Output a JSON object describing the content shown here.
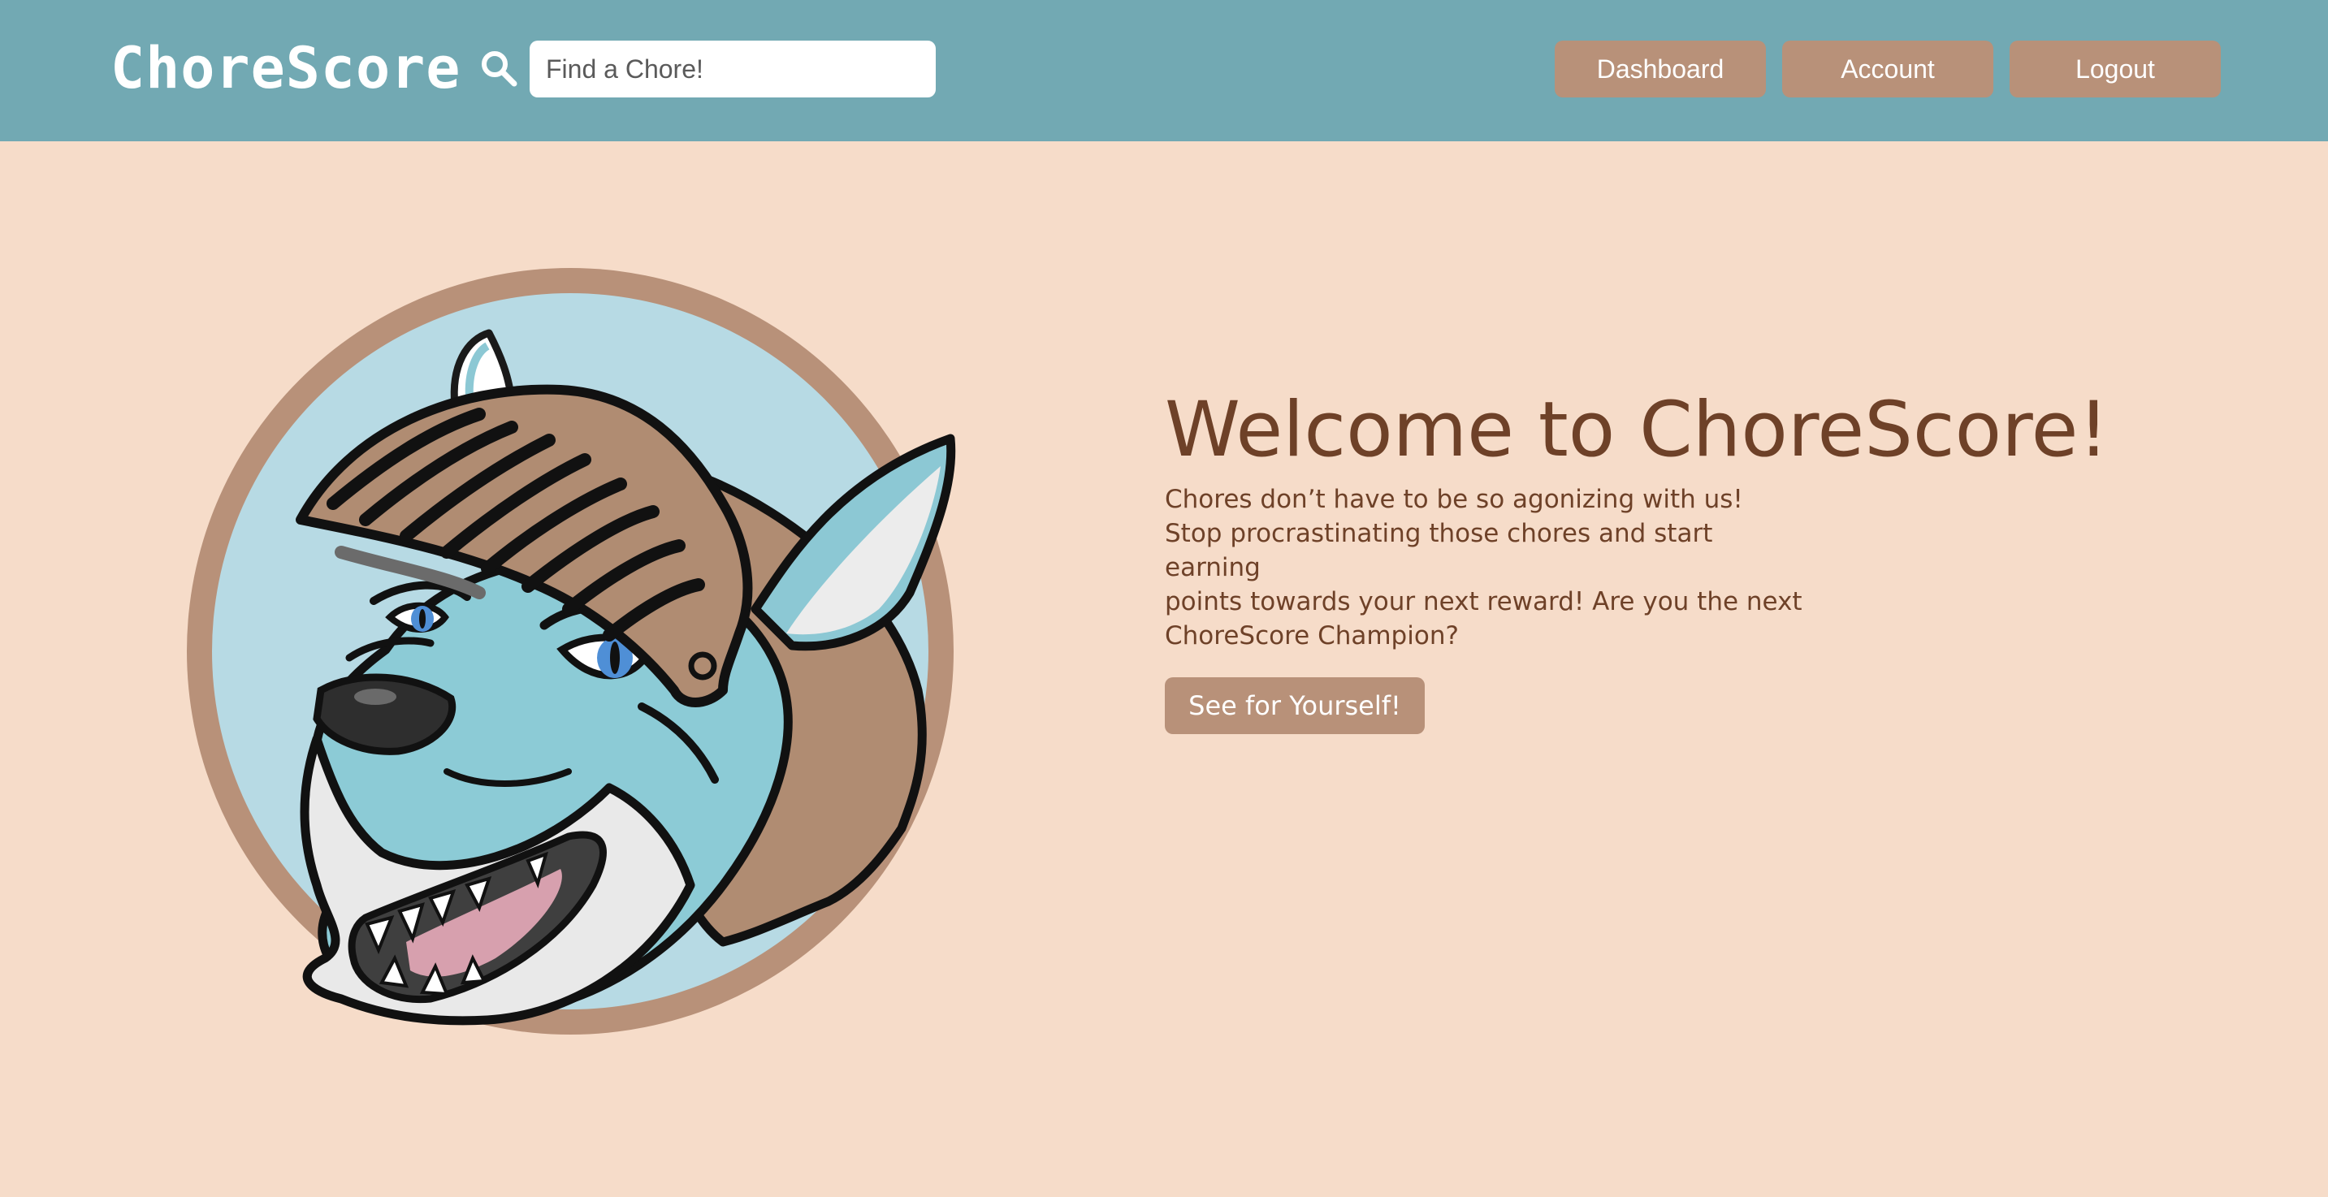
{
  "navbar": {
    "brand": "ChoreScore",
    "search": {
      "icon": "search-icon",
      "placeholder": "Find a Chore!",
      "value": ""
    },
    "buttons": {
      "dashboard": "Dashboard",
      "account": "Account",
      "logout": "Logout"
    }
  },
  "hero": {
    "image": "knight-wolf-mascot",
    "title": "Welcome to ChoreScore!",
    "lines": [
      "Chores don’t have to be so agonizing with us!",
      "Stop procrastinating those chores and start earning",
      "points towards your next reward! Are you the next",
      "ChoreScore Champion?"
    ],
    "cta_label": "See for Yourself!"
  },
  "colors": {
    "navbar_bg": "#72a9b3",
    "page_bg": "#f6dcc9",
    "button_bg": "#b89179",
    "heading_text": "#6e4128",
    "mascot_circle": "#b7dae4",
    "mascot_ring": "#b89179"
  }
}
